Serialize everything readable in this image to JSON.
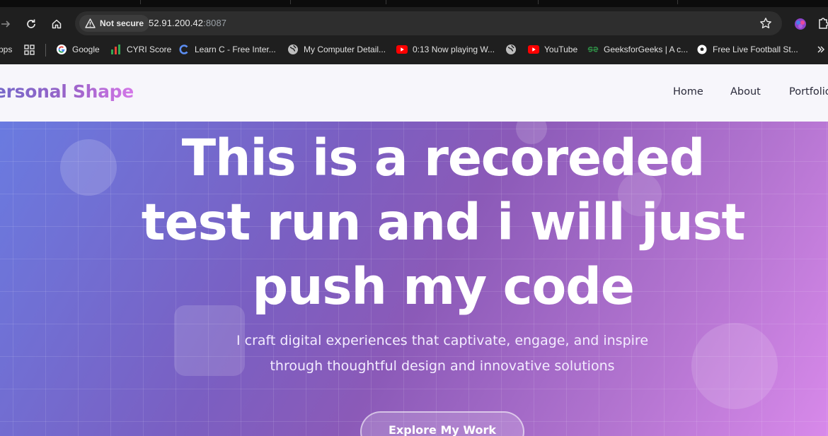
{
  "browser": {
    "security_label": "Not secure",
    "url_host": "52.91.200.42",
    "url_port": ":8087",
    "bookmarks": [
      {
        "label": "pps",
        "icon": "apps-text"
      },
      {
        "label": "",
        "icon": "grid-icon"
      },
      {
        "label": "Google",
        "icon": "google-icon"
      },
      {
        "label": "CYRI Score",
        "icon": "chart-icon"
      },
      {
        "label": "Learn C - Free Inter...",
        "icon": "c-language-icon"
      },
      {
        "label": "My Computer Detail...",
        "icon": "globe-icon"
      },
      {
        "label": "0:13 Now playing W...",
        "icon": "youtube-icon"
      },
      {
        "label": "",
        "icon": "globe-icon"
      },
      {
        "label": "YouTube",
        "icon": "youtube-icon"
      },
      {
        "label": "GeeksforGeeks | A c...",
        "icon": "gfg-icon"
      },
      {
        "label": "Free Live Football St...",
        "icon": "football-icon"
      }
    ]
  },
  "site": {
    "brand": "ersonal Shape",
    "nav": [
      "Home",
      "About",
      "Portfolio"
    ],
    "hero": {
      "title_lines": [
        "This is a recoreded",
        "test run and i will just",
        "push my code"
      ],
      "subtitle_lines": [
        "I craft digital experiences that captivate, engage, and inspire",
        "through thoughtful design and innovative solutions"
      ],
      "cta": "Explore My Work"
    }
  },
  "colors": {
    "brand_gradient_start": "#7468c9",
    "brand_gradient_end": "#d477e8",
    "hero_gradient_start": "#6a7be0",
    "hero_gradient_end": "#d889ea",
    "nav_background": "#f7f6fb"
  }
}
